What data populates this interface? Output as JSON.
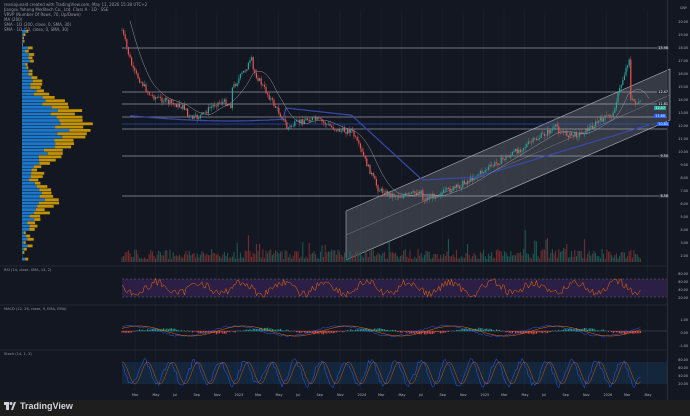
{
  "header": {
    "created_line": "rexsiajunaid created with TradingView.com, May 11, 2026 15:38 UTC+2",
    "symbol_line": "Jiangsu Yahong Meditech Co., Ltd. Class A · 1D · SSE",
    "vrvp_line": "VRVP (Number Of Rows, 70, Up/Down)",
    "ma_line": "MA (200)",
    "sma1_line": "SMA · 1D (200, close, 0, SMA, 30)",
    "sma2_line": "SMA · 1D (50, close, 0, SMA, 30)"
  },
  "currency": "CNY",
  "price_axis": [
    "20.00",
    "19.00",
    "18.00",
    "17.00",
    "16.00",
    "15.00",
    "14.00",
    "13.00",
    "12.00",
    "11.00",
    "10.00",
    "9.00",
    "8.00",
    "7.00",
    "6.00",
    "5.00",
    "4.00",
    "3.00",
    "2.00"
  ],
  "levels": [
    {
      "label": "15.98",
      "color": "#b2b5be"
    },
    {
      "label": "12.47",
      "color": "#b2b5be"
    },
    {
      "label": "11.81",
      "color": "#b2b5be"
    },
    {
      "label": "10.81",
      "color": "#2962ff"
    },
    {
      "label": "9.50",
      "color": "#b2b5be"
    },
    {
      "label": "6.58",
      "color": "#b2b5be"
    }
  ],
  "price_tags": [
    {
      "label": "12.47",
      "color": "#26a69a"
    },
    {
      "label": "11.60",
      "color": "#2962ff"
    }
  ],
  "time_axis": [
    "Mar",
    "May",
    "Jul",
    "Sep",
    "Nov",
    "2023",
    "Mar",
    "May",
    "Jul",
    "Sep",
    "Nov",
    "2024",
    "Mar",
    "May",
    "Jul",
    "Sep",
    "Nov",
    "2025",
    "Mar",
    "May",
    "Jul",
    "Sep",
    "Nov",
    "2026",
    "Mar",
    "May"
  ],
  "panels": {
    "rsi_label": "RSI (14, close, SMA, 14, 2)",
    "rsi_ticks": [
      "80.00",
      "60.00",
      "40.00",
      "20.00"
    ],
    "macd_label": "MACD (12, 26, close, 9, EMA, EMA)",
    "macd_ticks": [
      "1.00",
      "0.00",
      "-1.00"
    ],
    "stoch_label": "Stoch (14, 1, 3)",
    "stoch_ticks": [
      "80.00",
      "60.00",
      "40.00",
      "20.00"
    ]
  },
  "brand": "TradingView",
  "colors": {
    "bg": "#131722",
    "up": "#26a69a",
    "down": "#ef5350",
    "sma_blue": "#2962ff",
    "vrvp_up": "#e0a800",
    "vrvp_down": "#1e88e5",
    "rsi_band": "#2b1f45"
  }
}
